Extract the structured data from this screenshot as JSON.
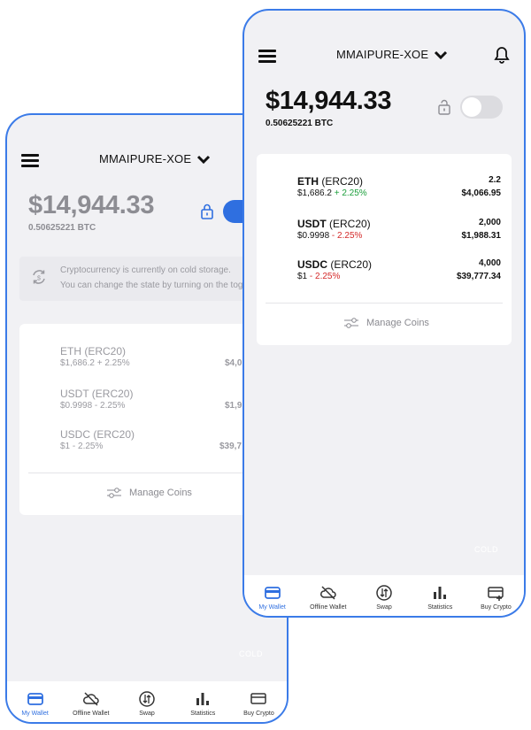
{
  "screens": {
    "back": {
      "account_name": "MMAIPURE-XOE",
      "balance_usd": "$14,944.33",
      "balance_btc": "0.50625221 BTC",
      "notice": {
        "line1": "Cryptocurrency is currently on cold storage.",
        "line2": "You can change the state by turning on the toggl"
      },
      "coins": [
        {
          "name": "ETH (ERC20)",
          "price": "$1,686.2",
          "change": " + 2.25%",
          "value": "$4,0"
        },
        {
          "name": "USDT (ERC20)",
          "price": "$0.9998",
          "change": " - 2.25%",
          "value": "$1,9"
        },
        {
          "name": "USDC (ERC20)",
          "price": "$1",
          "change": " - 2.25%",
          "value": "$39,7"
        }
      ],
      "manage_label": "Manage Coins",
      "cold_label": "COLD",
      "toggle_on": true
    },
    "front": {
      "account_name": "MMAIPURE-XOE",
      "balance_usd": "$14,944.33",
      "balance_btc": "0.50625221 BTC",
      "coins": [
        {
          "name": "ETH",
          "suffix": " (ERC20)",
          "price": "$1,686.2",
          "change": " + 2.25%",
          "direction": "up",
          "qty": "2.2",
          "value": "$4,066.95"
        },
        {
          "name": "USDT",
          "suffix": " (ERC20)",
          "price": "$0.9998",
          "change": " - 2.25%",
          "direction": "down",
          "qty": "2,000",
          "value": "$1,988.31"
        },
        {
          "name": "USDC",
          "suffix": " (ERC20)",
          "price": "$1",
          "change": " - 2.25%",
          "direction": "down",
          "qty": "4,000",
          "value": "$39,777.34"
        }
      ],
      "manage_label": "Manage Coins",
      "cold_label": "COLD",
      "toggle_on": false
    }
  },
  "tabs": [
    {
      "label": "My Wallet",
      "icon": "wallet-icon",
      "active": true
    },
    {
      "label": "Offline Wallet",
      "icon": "cloud-off-icon",
      "active": false
    },
    {
      "label": "Swap",
      "icon": "swap-icon",
      "active": false
    },
    {
      "label": "Statistics",
      "icon": "statistics-icon",
      "active": false
    },
    {
      "label": "Buy Crypto",
      "icon": "card-add-icon",
      "active": false
    }
  ],
  "colors": {
    "accent": "#2f6fe0",
    "frame": "#3b7be8",
    "up": "#1a9e3a",
    "down": "#d42a2a",
    "background": "#f1f1f4"
  }
}
